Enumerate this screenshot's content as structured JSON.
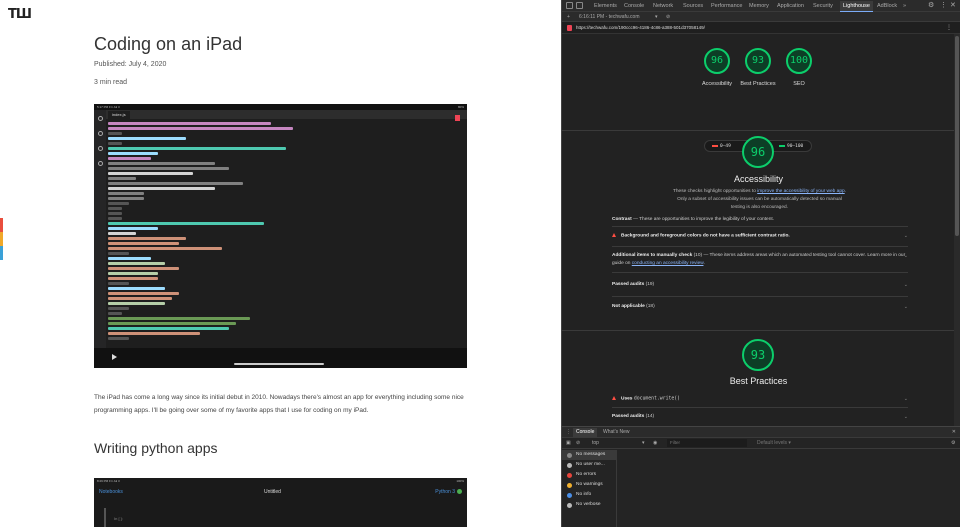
{
  "blog": {
    "logo": "ТШ",
    "title": "Coding on an iPad",
    "published": "Published: July 4, 2020",
    "read_time": "3 min read",
    "paragraph": "The iPad has come a long way since its initial debut in 2010. Nowadays there's almost an app for everything including some nice programming apps. I'll be going over some of my favorite apps that I use for coding on my iPad.",
    "section_heading": "Writing python apps",
    "shot1": {
      "status_left": "5:17 PM  Fri Jul 3",
      "status_right": "80%",
      "tab": "index.js"
    },
    "shot2": {
      "status_left": "8:29 PM  Fri Jul 3",
      "status_right": "100%",
      "notebooks": "Notebooks",
      "title": "Untitled",
      "kernel": "Python 3",
      "cell_prompt": "In [ ]:"
    }
  },
  "devtools": {
    "tabs": [
      "Elements",
      "Console",
      "Network",
      "Sources",
      "Performance",
      "Memory",
      "Application",
      "Security",
      "Lighthouse",
      "AdBlock"
    ],
    "active_tab": "Lighthouse",
    "more": "»",
    "session": "6:16:11 PM - techwafu.com",
    "url": "https://techwafu.com/190ccc96-4186-4c86-a388-501d37058149/",
    "lighthouse": {
      "scores": [
        {
          "label": "Accessibility",
          "score": "96"
        },
        {
          "label": "Best Practices",
          "score": "93"
        },
        {
          "label": "SEO",
          "score": "100"
        }
      ],
      "legend": [
        {
          "label": "0–49",
          "color": "#ff4e42"
        },
        {
          "label": "50–89",
          "color": "#ffa400"
        },
        {
          "label": "90–100",
          "color": "#0cce6b"
        }
      ],
      "accessibility": {
        "score": "96",
        "title": "Accessibility",
        "desc_pre": "These checks highlight opportunities to",
        "desc_link": "improve the accessibility of your web app",
        "desc_post": ". Only a subset of accessibility issues can be automatically detected so manual testing is also encouraged.",
        "contrast_label": "Contrast",
        "contrast_desc": " — These are opportunities to improve the legibility of your content.",
        "contrast_audit": "Background and foreground colors do not have a sufficient contrast ratio.",
        "manual_label": "Additional items to manually check",
        "manual_count": " (10)",
        "manual_desc": " — These items address areas which an automated testing tool cannot cover. Learn more in our guide on ",
        "manual_link": "conducting an accessibility review",
        "manual_end": ".",
        "passed_label": "Passed audits",
        "passed_count": " (19)",
        "na_label": "Not applicable",
        "na_count": " (18)"
      },
      "best_practices": {
        "score": "93",
        "title": "Best Practices",
        "audit_pre": "Uses ",
        "audit_code": "document.write()",
        "passed_label": "Passed audits",
        "passed_count": " (14)"
      }
    },
    "drawer": {
      "tabs": [
        "Console",
        "What's New"
      ],
      "context": "top",
      "filter_placeholder": "Filter",
      "levels": "Default levels ▾",
      "sidebar": [
        {
          "label": "No messages",
          "color": "#888888"
        },
        {
          "label": "No user me...",
          "color": "#bbbbbb"
        },
        {
          "label": "No errors",
          "color": "#e8453c"
        },
        {
          "label": "No warnings",
          "color": "#f2b02e"
        },
        {
          "label": "No info",
          "color": "#4a8fe8"
        },
        {
          "label": "No verbose",
          "color": "#bbbbbb"
        }
      ]
    }
  }
}
